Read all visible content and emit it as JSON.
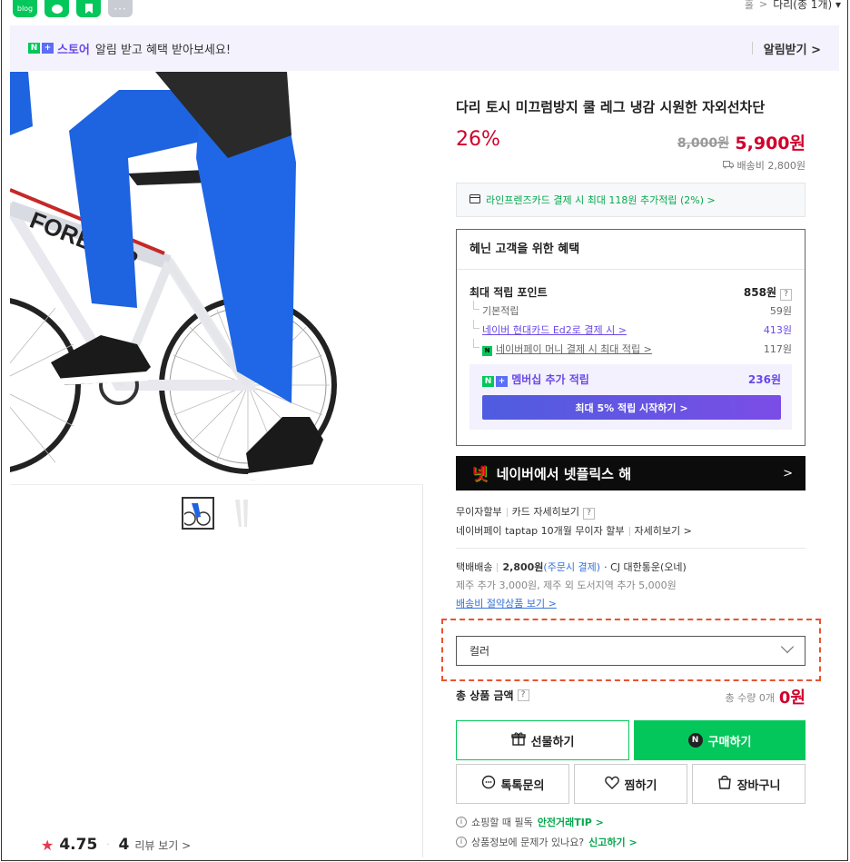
{
  "share": {
    "blog_label": "blog",
    "more_label": "···"
  },
  "breadcrumb": {
    "prev": "홀",
    "sep": ">",
    "current": "다리(총 1개) ▾"
  },
  "notice": {
    "store_label": "스토어",
    "message": "알림 받고 혜택 받아보세요!",
    "action": "알림받기 >"
  },
  "gallery": {
    "thumb_count": 2
  },
  "rating": {
    "score": "4.75",
    "reviews": "4",
    "review_link": "리뷰 보기 >"
  },
  "product": {
    "title": "다리 토시 미끄럼방지 쿨 레그 냉감 시원한 자외선차단",
    "discount": "26%",
    "original_price": "8,000원",
    "price": "5,900원",
    "shipping": "배송비 2,800원"
  },
  "card_promo": "라인프렌즈카드 결제 시 최대 118원 추가적립 (2%) >",
  "benefits": {
    "title": "헤닌 고객을 위한 혜택",
    "max_point_label": "최대 적립 포인트",
    "max_point_value": "858원",
    "rows": [
      {
        "label": "기본적립",
        "value": "59원"
      },
      {
        "label": "네이버 현대카드 Ed2로 결제 시 >",
        "value": "413원"
      },
      {
        "label": "네이버페이 머니 결제 시 최대 적립 >",
        "value": "117원"
      }
    ],
    "membership_label": "멤버십 추가 적립",
    "membership_value": "236원",
    "membership_button": "최대 5% 적립 시작하기 >"
  },
  "netflix": {
    "logo": "넷",
    "text": "네이버에서 넷플릭스 해",
    "arrow": ">"
  },
  "installment": {
    "line1_a": "무이자할부",
    "line1_b": "카드 자세히보기",
    "line2_a": "네이버페이 taptap 10개월 무이자 할부",
    "line2_b": "자세히보기 >"
  },
  "delivery": {
    "method": "택배배송",
    "fee": "2,800원",
    "fee_note": "(주문시 결제)",
    "carrier": "· CJ 대한통운(오네)",
    "extra": "제주 추가 3,000원, 제주 외 도서지역 추가 5,000원",
    "saving_link": "배송비 절약상품 보기 >"
  },
  "option": {
    "placeholder": "컬러"
  },
  "total": {
    "label": "총 상품 금액",
    "qty": "총 수량 0개",
    "amount": "0원"
  },
  "buttons": {
    "gift": "선물하기",
    "buy": "구매하기",
    "talk": "톡톡문의",
    "wish": "찜하기",
    "cart": "장바구니"
  },
  "footer": {
    "tip_prefix": "쇼핑할 때 필독",
    "tip_link": "안전거래TIP >",
    "report_prefix": "상품정보에 문제가 있나요?",
    "report_link": "신고하기 >"
  },
  "colors": {
    "naver_green": "#03c75a",
    "price_red": "#d0012c",
    "purple": "#6a49e6"
  }
}
